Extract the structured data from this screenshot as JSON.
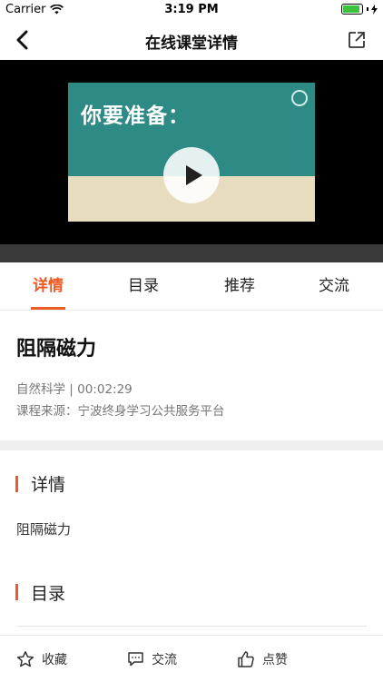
{
  "status": {
    "carrier": "Carrier",
    "time": "3:19 PM"
  },
  "nav": {
    "title": "在线课堂详情",
    "back_icon": "chevron-left-icon",
    "share_icon": "share-icon"
  },
  "video": {
    "thumbnail_text": "你要准备：",
    "play_icon": "play-icon"
  },
  "tabs": [
    {
      "label": "详情",
      "active": true
    },
    {
      "label": "目录",
      "active": false
    },
    {
      "label": "推荐",
      "active": false
    },
    {
      "label": "交流",
      "active": false
    }
  ],
  "course": {
    "title": "阻隔磁力",
    "meta": "自然科学 | 00:02:29",
    "source": "课程来源：宁波终身学习公共服务平台"
  },
  "sections": {
    "detail_title": "详情",
    "detail_body": "阻隔磁力",
    "catalog_title": "目录"
  },
  "bottom_bar": {
    "favorite_label": "收藏",
    "comment_label": "交流",
    "like_label": "点赞"
  },
  "colors": {
    "accent": "#ee5a24",
    "video_bg": "#000000"
  }
}
